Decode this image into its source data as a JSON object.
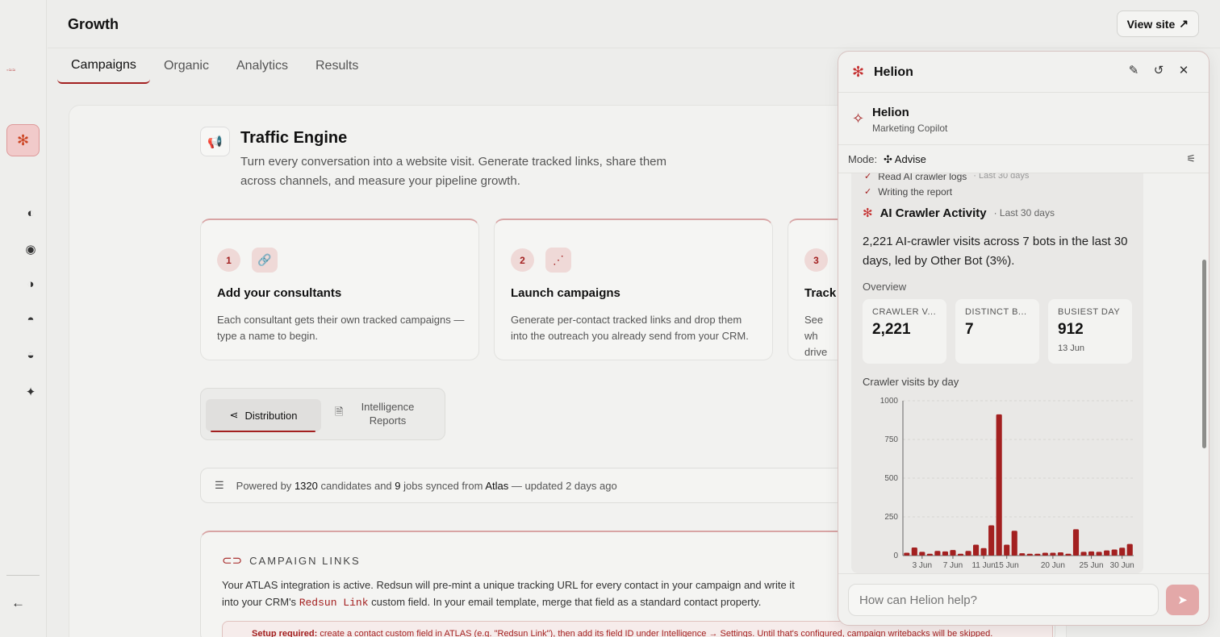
{
  "header": {
    "title": "Growth",
    "view_site_label": "View site",
    "view_site_icon": "external-arrow-icon"
  },
  "tabs": [
    {
      "label": "Campaigns",
      "active": true
    },
    {
      "label": "Organic"
    },
    {
      "label": "Analytics"
    },
    {
      "label": "Results"
    }
  ],
  "hero": {
    "title": "Traffic Engine",
    "description": "Turn every conversation into a website visit. Generate tracked links, share them across channels, and measure your pipeline growth."
  },
  "steps": [
    {
      "number": "1",
      "icon": "link-icon",
      "title": "Add your consultants",
      "description": "Each consultant gets their own tracked campaigns — type a name to begin."
    },
    {
      "number": "2",
      "icon": "share-icon",
      "title": "Launch campaigns",
      "description": "Generate per-contact tracked links and drop them into the outreach you already send from your CRM."
    },
    {
      "number": "3",
      "icon": "",
      "title": "Track",
      "description": "See wh drive th"
    }
  ],
  "segmented": {
    "distribution_label": "Distribution",
    "intel_label": "Intelligence Reports"
  },
  "powered": {
    "prefix": "Powered by",
    "candidates": "1320",
    "mid1": "candidates and",
    "jobs": "9",
    "mid2": "jobs synced from",
    "source": "Atlas",
    "suffix": "— updated 2 days ago"
  },
  "campaign_links": {
    "heading": "CAMPAIGN LINKS",
    "text_before": "Your ATLAS integration is active. Redsun will pre-mint a unique tracking URL for every contact in your campaign and write it into your CRM's",
    "code": "Redsun Link",
    "text_after": "custom field. In your email template, merge that field as a standard contact property.",
    "setup_label": "Setup required:",
    "setup_text": "create a contact custom field in ATLAS (e.g. \"Redsun Link\"), then add its field ID under Intelligence → Settings. Until that's configured, campaign writebacks will be skipped."
  },
  "panel": {
    "title": "Helion",
    "agent_name": "Helion",
    "agent_subtitle": "Marketing Copilot",
    "mode_label": "Mode:",
    "mode_value": "Advise",
    "steps": [
      {
        "label": "Read AI crawler logs",
        "meta": "· Last 30 days"
      },
      {
        "label": "Writing the report",
        "meta": ""
      }
    ],
    "section_title": "AI Crawler Activity",
    "section_period": "· Last 30 days",
    "summary": "2,221 AI-crawler visits across 7 bots in the last 30 days, led by Other Bot (3%).",
    "overview_label": "Overview",
    "kpis": [
      {
        "label": "CRAWLER V...",
        "value": "2,221",
        "sub": ""
      },
      {
        "label": "DISTINCT B...",
        "value": "7",
        "sub": ""
      },
      {
        "label": "BUSIEST DAY",
        "value": "912",
        "sub": "13 Jun"
      }
    ],
    "chart_title": "Crawler visits by day",
    "input_placeholder": "How can Helion help?"
  },
  "colors": {
    "accent": "#a32020",
    "accent_light": "#efd9d7",
    "send_disabled": "#e3a8a8"
  },
  "chart_data": {
    "type": "bar",
    "title": "Crawler visits by day",
    "ylim": [
      0,
      1000
    ],
    "yticks": [
      0,
      250,
      500,
      750,
      1000
    ],
    "xtick_labels": [
      "3 Jun",
      "7 Jun",
      "11 Jun",
      "15 Jun",
      "20 Jun",
      "25 Jun",
      "30 Jun"
    ],
    "xtick_index": [
      2,
      6,
      10,
      13,
      19,
      24,
      28
    ],
    "categories": [
      "1 Jun",
      "2 Jun",
      "3 Jun",
      "4 Jun",
      "5 Jun",
      "6 Jun",
      "7 Jun",
      "8 Jun",
      "9 Jun",
      "10 Jun",
      "11 Jun",
      "12 Jun",
      "13 Jun",
      "14 Jun",
      "15 Jun",
      "16 Jun",
      "17 Jun",
      "18 Jun",
      "19 Jun",
      "20 Jun",
      "21 Jun",
      "22 Jun",
      "23 Jun",
      "24 Jun",
      "25 Jun",
      "26 Jun",
      "27 Jun",
      "28 Jun",
      "29 Jun",
      "30 Jun"
    ],
    "values": [
      18,
      52,
      24,
      12,
      30,
      27,
      36,
      12,
      30,
      70,
      48,
      195,
      912,
      70,
      160,
      15,
      12,
      12,
      18,
      18,
      21,
      12,
      170,
      24,
      27,
      24,
      33,
      39,
      51,
      75
    ],
    "grid": true
  }
}
